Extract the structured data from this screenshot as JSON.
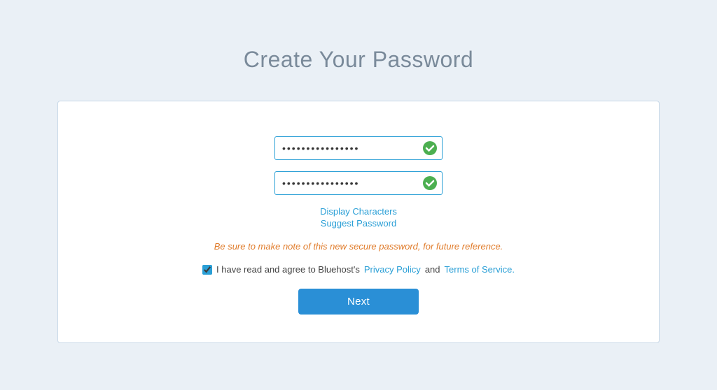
{
  "page": {
    "title": "Create Your Password",
    "background_color": "#eaf0f6"
  },
  "card": {
    "password_placeholder": "••••••••••••••••",
    "confirm_placeholder": "••••••••••••••••",
    "display_characters_label": "Display Characters",
    "suggest_password_label": "Suggest Password",
    "warning_text": "Be sure to make note of this new secure password, for future reference.",
    "agreement_prefix": "I have read and agree to Bluehost's",
    "privacy_policy_label": "Privacy Policy",
    "agreement_mid": "and",
    "terms_label": "Terms of Service",
    "agreement_suffix": ".",
    "next_button_label": "Next",
    "checkbox_checked": true
  }
}
